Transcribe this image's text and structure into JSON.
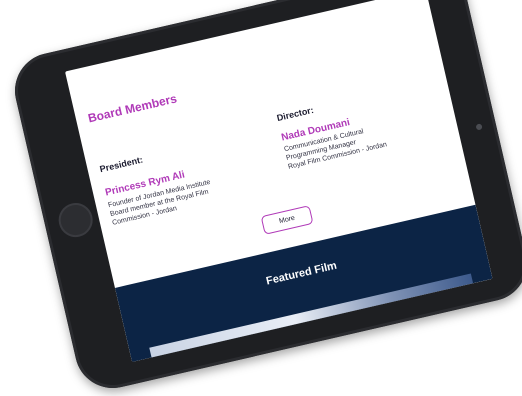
{
  "board": {
    "heading": "Board Members",
    "president": {
      "role": "President:",
      "name": "Princess Rym Ali",
      "lines": [
        "Founder of Jordan Media Institute",
        "Board member at the Royal Film",
        "Commission - Jordan"
      ]
    },
    "director": {
      "role": "Director:",
      "name": "Nada Doumani",
      "lines": [
        "Communication & Cultural",
        "Programming Manager",
        "Royal Film Commission - Jordan"
      ]
    },
    "more_label": "More"
  },
  "featured": {
    "title": "Featured Film"
  },
  "colors": {
    "accent": "#b03ab8",
    "navy": "#0c2445",
    "device": "#1e1f22"
  }
}
